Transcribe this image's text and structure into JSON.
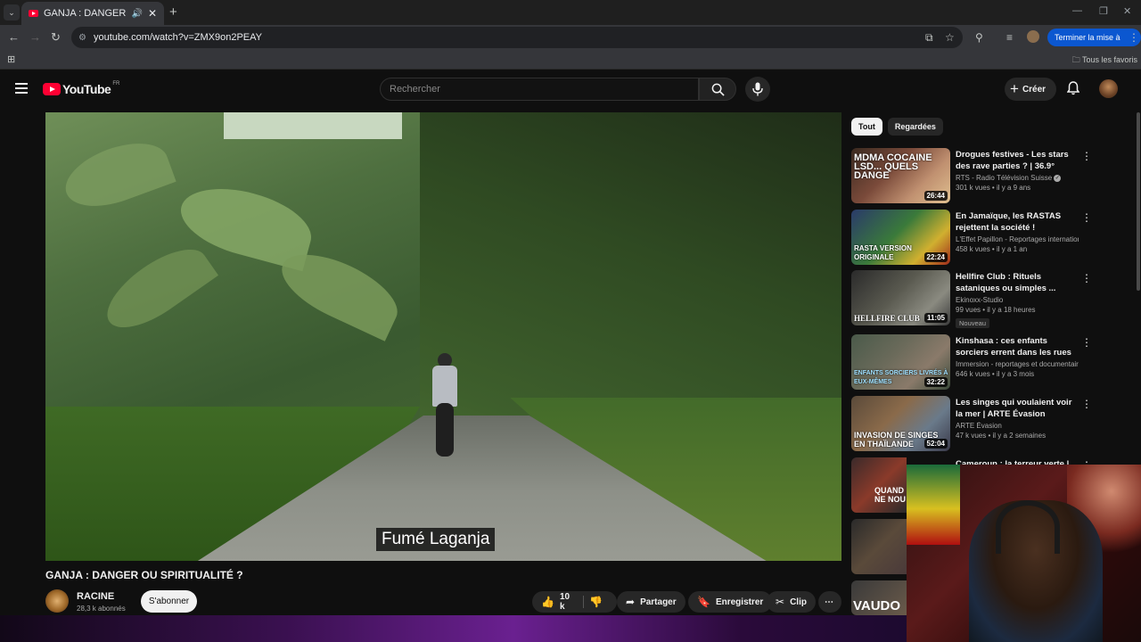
{
  "browser": {
    "tab_title": "GANJA : DANGER OU SPIRI",
    "url": "youtube.com/watch?v=ZMX9on2PEAY",
    "update_button": "Terminer la mise à jour",
    "bookmarks_all": "Tous les favoris"
  },
  "header": {
    "logo_text": "YouTube",
    "logo_region": "FR",
    "search_placeholder": "Rechercher",
    "create_label": "Créer"
  },
  "player": {
    "subtitle": "Fumé Laganja"
  },
  "video": {
    "title": "GANJA : DANGER OU SPIRITUALITÉ ?",
    "channel": "RACINE",
    "subscribers": "28,3 k abonnés",
    "subscribe_label": "S'abonner",
    "likes": "10 k",
    "share_label": "Partager",
    "save_label": "Enregistrer",
    "clip_label": "Clip"
  },
  "sidebar": {
    "chips": [
      "Tout",
      "Regardées"
    ],
    "recommendations": [
      {
        "title": "Drogues festives - Les stars des rave parties ? | 36.9°",
        "channel": "RTS - Radio Télévision Suisse",
        "stats": "301 k vues • il y a 9 ans",
        "duration": "26:44",
        "thumb_text": "MDMA COCAINE LSD... QUELS DANGE"
      },
      {
        "title": "En Jamaïque, les RASTAS rejettent la société !",
        "channel": "L'Effet Papillon - Reportages internationa...",
        "stats": "458 k vues • il y a 1 an",
        "duration": "22:24",
        "thumb_text": "RASTA VERSION ORIGINALE"
      },
      {
        "title": "Hellfire Club : Rituels sataniques ou simples ...",
        "channel": "Ekinoxx-Studio",
        "stats": "99 vues • il y a 18 heures",
        "duration": "11:05",
        "thumb_text": "HELLFIRE CLUB",
        "badge": "Nouveau"
      },
      {
        "title": "Kinshasa : ces enfants sorciers errent dans les rues",
        "channel": "Immersion - reportages et documentair...",
        "stats": "646 k vues • il y a 3 mois",
        "duration": "32:22",
        "thumb_text": "ENFANTS SORCIERS LIVRÉS À EUX-MÊMES"
      },
      {
        "title": "Les singes qui voulaient voir la mer | ARTE Évasion",
        "channel": "ARTE Évasion",
        "stats": "47 k vues • il y a 2 semaines",
        "duration": "52:04",
        "thumb_text": "INVASION DE SINGES EN THAÏLANDE"
      },
      {
        "title": "Cameroun : la terreur verte |",
        "thumb_text": "QUAND NE NOU"
      }
    ],
    "partial_thumb_text": "VAUDO"
  }
}
